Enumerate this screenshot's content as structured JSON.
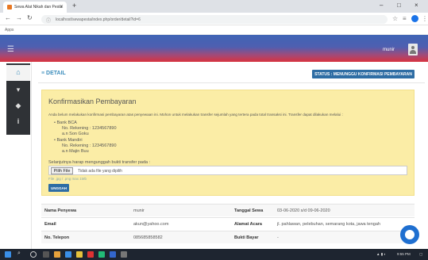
{
  "browser": {
    "tab_title": "Sewa Alat Nikah dan Pesta",
    "new_tab": "+",
    "url": "localhost/sewapesta/index.php/order/detail?id=6",
    "bookmarks": "Apps",
    "window_controls": [
      "–",
      "□",
      "×"
    ]
  },
  "header": {
    "menu_icon": "hamburger-icon",
    "username": "munir"
  },
  "sidebar": {
    "items": [
      {
        "icon": "home-icon",
        "symbol": "⌂"
      },
      {
        "icon": "cart-icon",
        "symbol": "▾"
      },
      {
        "icon": "tag-icon",
        "symbol": "◆"
      },
      {
        "icon": "info-icon",
        "symbol": "i"
      }
    ]
  },
  "page": {
    "title": "≡ DETAIL",
    "status_button": "STATUS : MENUNGGU KONFIRMASI PEMBAYARAN"
  },
  "confirm": {
    "heading": "Konfirmasikan Pembayaran",
    "intro": "Anda belum melakukan konfirmasi pembayaran atas penyewaan ini. Mohon untuk melakukan transfer sejumlah yang tertera pada total transaksi ini. Transfer dapat dilakukan melalui :",
    "banks": [
      {
        "name": "Bank BCA",
        "rekening": "No. Rekening : 1234567890",
        "an": "a.n Son Goku"
      },
      {
        "name": "Bank Mandiri",
        "rekening": "No. Rekening : 1234567890",
        "an": "a.n Majin Buu"
      }
    ],
    "upload_label": "Selanjutnya harap mengunggah bukti transfer pada :",
    "file_button": "Pilih File",
    "file_status": "Tidak ada file yang dipilih",
    "hint": "File .jpg / .png max 1Mb",
    "upload_button": "UNGGAH"
  },
  "info": {
    "rows": [
      {
        "k1": "Nama Penyewa",
        "v1": "munir",
        "k2": "Tanggal Sewa",
        "v2": "03-06-2020 s/d 09-06-2020"
      },
      {
        "k1": "Email",
        "v1": "akun@yahoo.com",
        "k2": "Alamat Acara",
        "v2": "jl. pahlawan, pelebuhan, semarang kota, jawa tengah"
      },
      {
        "k1": "No. Telepon",
        "v1": "085685858582",
        "k2": "Bukti Bayar",
        "v2": "-"
      }
    ]
  },
  "taskbar": {
    "time": "9:55 PM"
  },
  "colors": {
    "header_top": "#3f64b5",
    "header_bottom": "#d8323f",
    "primary": "#2e6da4",
    "alert_bg": "#fbeda6",
    "sidebar_dark": "#2f3236"
  }
}
